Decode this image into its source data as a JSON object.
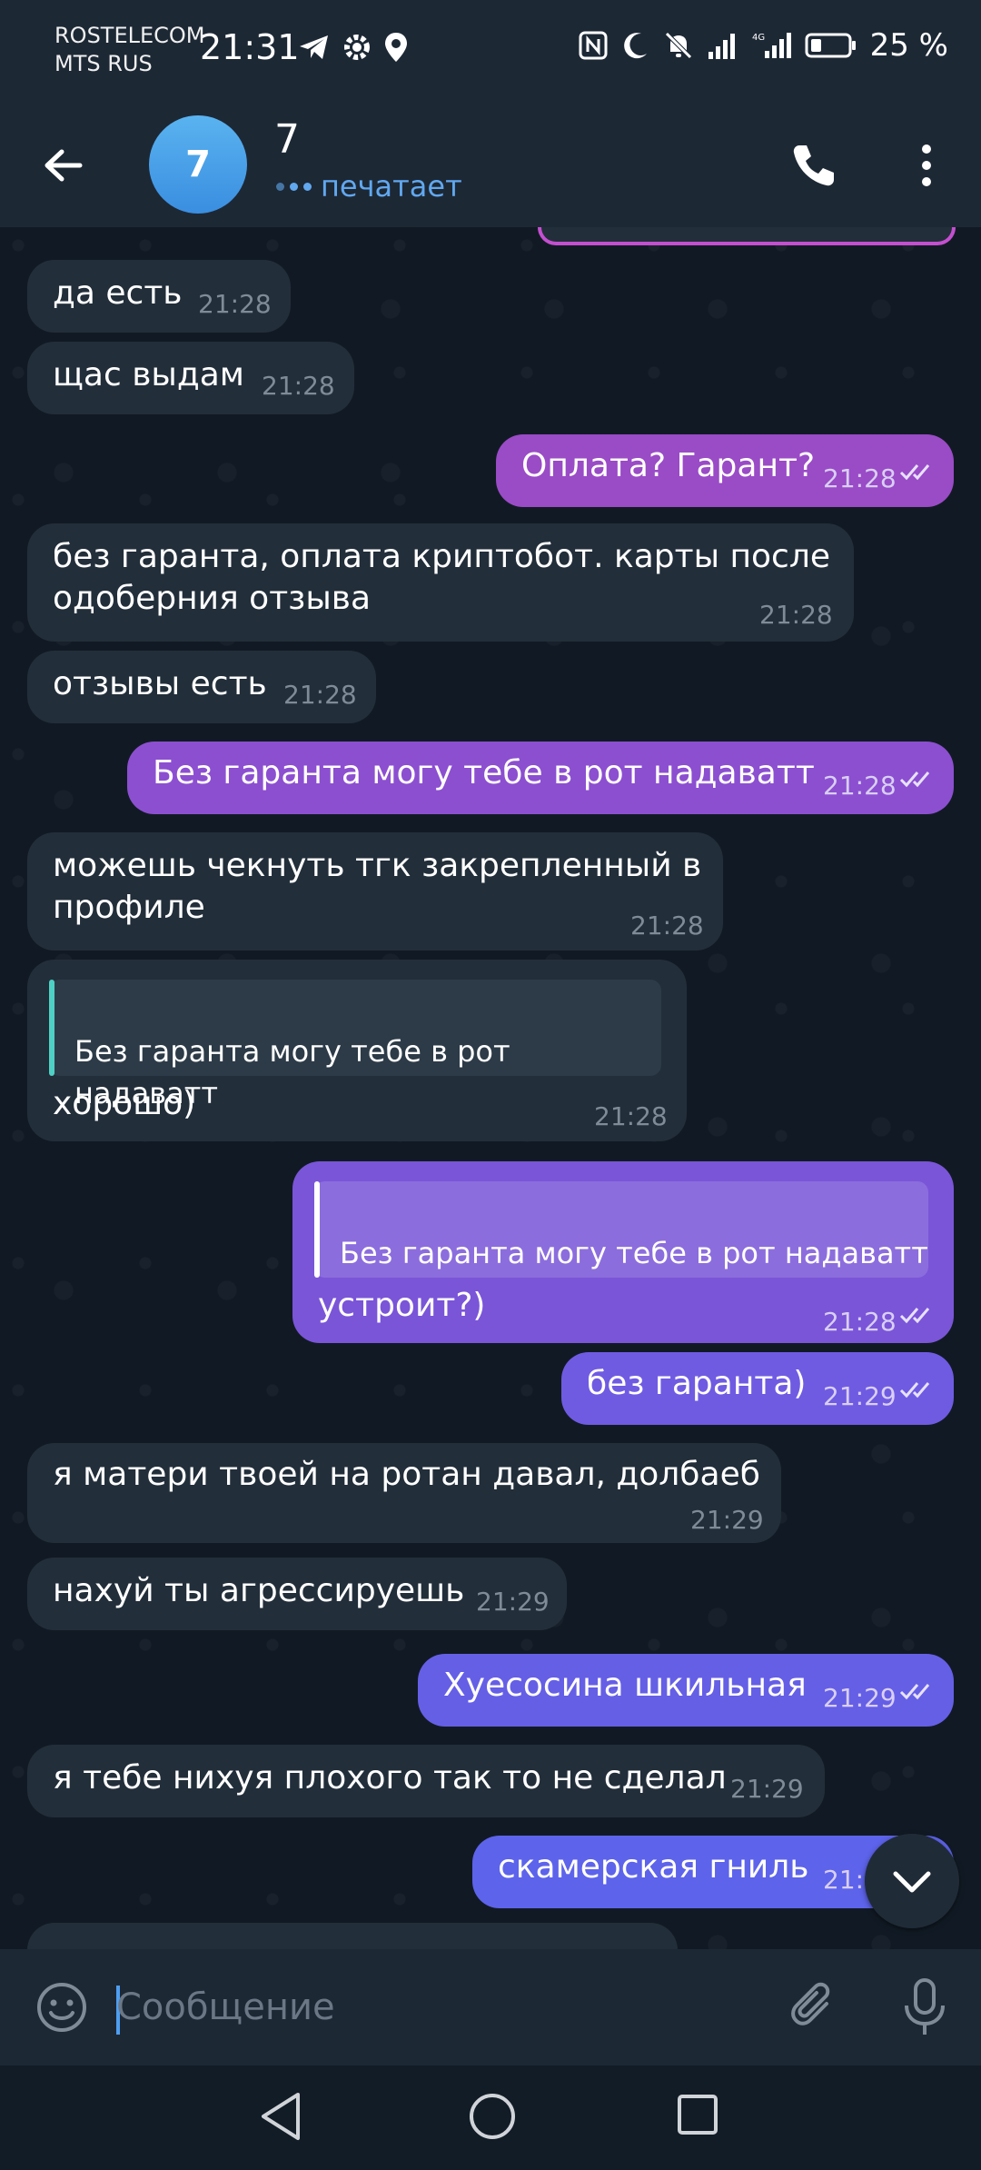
{
  "status_bar": {
    "carrier_1": "ROSTELECOM",
    "carrier_2": "MTS RUS",
    "time": "21:31",
    "battery": "25 %"
  },
  "header": {
    "avatar_letter": "7",
    "title": "7",
    "status": "печатает"
  },
  "messages": [
    {
      "dir": "in",
      "text": "да есть",
      "time": "21:28"
    },
    {
      "dir": "in",
      "text": "щас выдам",
      "time": "21:28"
    },
    {
      "dir": "out",
      "text": "Оплата? Гарант?",
      "time": "21:28"
    },
    {
      "dir": "in",
      "line1": "без гаранта, оплата криптобот. карты после",
      "line2": "одоберния отзыва",
      "time": "21:28"
    },
    {
      "dir": "in",
      "text": "отзывы есть",
      "time": "21:28"
    },
    {
      "dir": "out",
      "text": "Без гаранта могу тебе в рот надаватт",
      "time": "21:28"
    },
    {
      "dir": "in",
      "line1": "можешь чекнуть тгк закрепленный в",
      "line2": "профиле",
      "time": "21:28"
    },
    {
      "dir": "in",
      "quote": "Без гаранта могу тебе в рот надаватт",
      "text": "хорошо)",
      "time": "21:28"
    },
    {
      "dir": "out",
      "quote": "Без гаранта могу тебе в рот надаватт",
      "text": "устроит?)",
      "time": "21:28"
    },
    {
      "dir": "out",
      "text": "без гаранта)",
      "time": "21:29"
    },
    {
      "dir": "in",
      "text": "я матери твоей на ротан давал, долбаеб",
      "time": "21:29"
    },
    {
      "dir": "in",
      "text": "нахуй ты агрессируешь",
      "time": "21:29"
    },
    {
      "dir": "out",
      "text": "Хуесосина шкильная",
      "time": "21:29"
    },
    {
      "dir": "in",
      "text": "я тебе нихуя плохого так то не сделал",
      "time": "21:29"
    },
    {
      "dir": "out",
      "text": "скамерская гниль",
      "time": "21:"
    }
  ],
  "input": {
    "placeholder": "Сообщение"
  },
  "icons": {
    "back": "arrow-left-icon",
    "call": "phone-icon",
    "more": "more-vertical-icon",
    "emoji": "emoji-icon",
    "attach": "paperclip-icon",
    "mic": "microphone-icon"
  },
  "colors": {
    "header_bg": "#1d2835",
    "incoming_bubble": "#222e3a",
    "outgoing_bubble_start": "#9a4bc6",
    "outgoing_bubble_end": "#5d63ea",
    "accent": "#61a8ef"
  }
}
